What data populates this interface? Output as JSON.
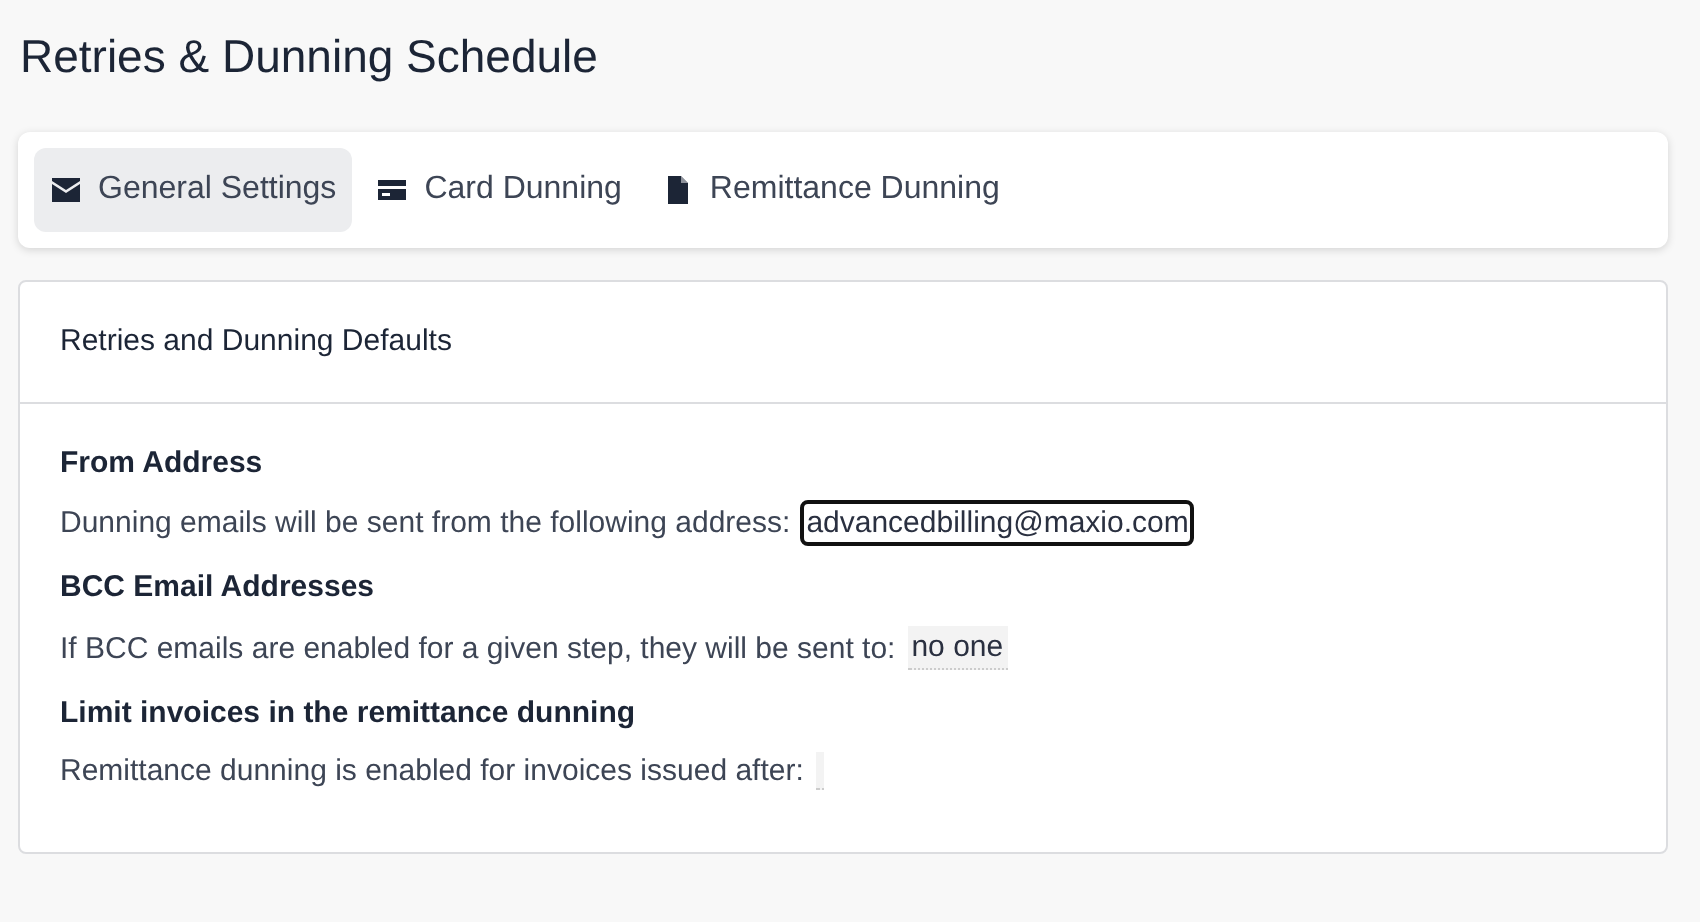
{
  "page_title": "Retries & Dunning Schedule",
  "tabs": [
    {
      "label": "General Settings",
      "kind": "envelope",
      "selected": true
    },
    {
      "label": "Card Dunning",
      "kind": "card",
      "selected": false
    },
    {
      "label": "Remittance Dunning",
      "kind": "file",
      "selected": false
    }
  ],
  "panel": {
    "title": "Retries and Dunning Defaults",
    "sections": [
      {
        "heading": "From Address",
        "text": "Dunning emails will be sent from the following address:",
        "field": {
          "value": "advancedbilling@maxio.com",
          "focused": true
        }
      },
      {
        "heading": "BCC Email Addresses",
        "text": "If BCC emails are enabled for a given step, they will be sent to:",
        "field": {
          "value": "no one",
          "focused": false
        }
      },
      {
        "heading": "Limit invoices in the remittance dunning",
        "text": "Remittance dunning is enabled for invoices issued after:",
        "field": {
          "focused": false
        }
      }
    ]
  }
}
